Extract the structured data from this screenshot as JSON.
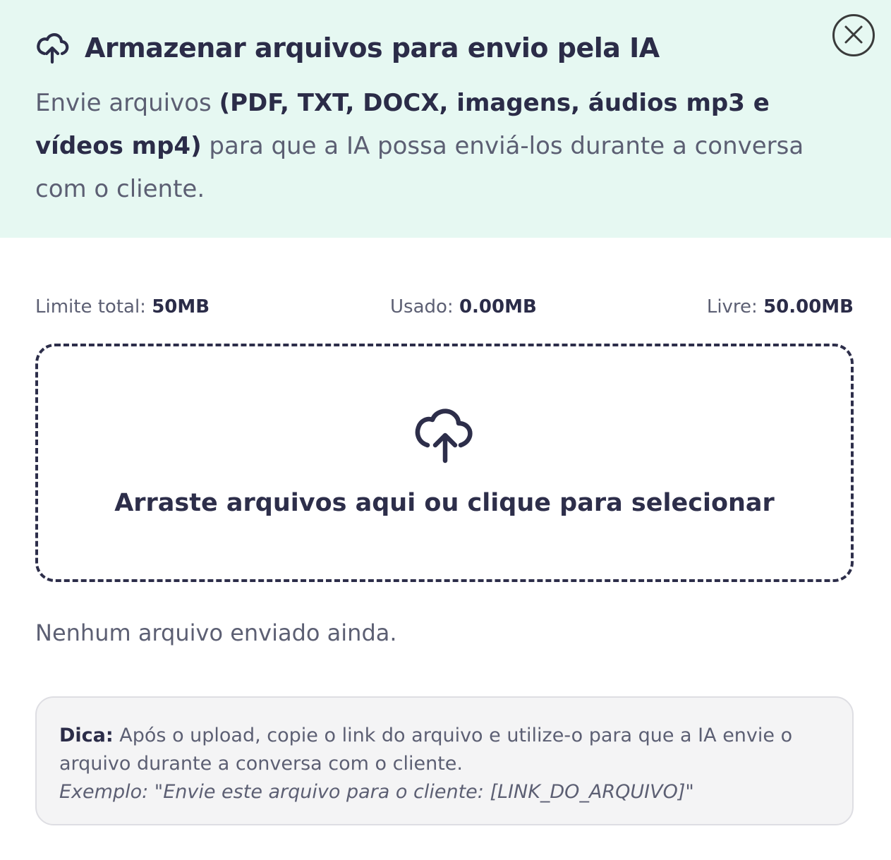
{
  "header": {
    "title": "Armazenar arquivos para envio pela IA",
    "description_prefix": "Envie arquivos ",
    "description_bold": "(PDF, TXT, DOCX, imagens, áudios mp3 e vídeos mp4)",
    "description_suffix": " para que a IA possa enviá-los durante a conversa com o cliente.",
    "close_icon": "close-icon",
    "title_icon": "cloud-upload-icon"
  },
  "storage": {
    "limit_label": "Limite total: ",
    "limit_value": "50MB",
    "used_label": "Usado: ",
    "used_value": "0.00MB",
    "free_label": "Livre: ",
    "free_value": "50.00MB"
  },
  "dropzone": {
    "icon": "cloud-upload-icon",
    "text": "Arraste arquivos aqui ou clique para selecionar"
  },
  "files": {
    "empty_message": "Nenhum arquivo enviado ainda."
  },
  "tip": {
    "label": "Dica:",
    "text": " Após o upload, copie o link do arquivo e utilize-o para que a IA envie o arquivo durante a conversa com o cliente.",
    "example": "Exemplo: \"Envie este arquivo para o cliente: [LINK_DO_ARQUIVO]\""
  },
  "colors": {
    "header_bg": "#e6f8f2",
    "text_dark": "#2b2c48",
    "text_muted": "#5c5f73",
    "tip_bg": "#f4f4f5"
  }
}
